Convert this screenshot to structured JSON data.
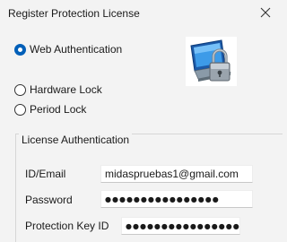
{
  "window": {
    "title": "Register Protection License",
    "close_icon": "close-icon"
  },
  "license_type": {
    "options": [
      {
        "label": "Web Authentication",
        "checked": true
      },
      {
        "label": "Hardware Lock",
        "checked": false
      },
      {
        "label": "Period Lock",
        "checked": false
      }
    ]
  },
  "logo": {
    "icon": "computer-padlock-icon"
  },
  "auth_group": {
    "legend": "License Authentication",
    "fields": {
      "email": {
        "label": "ID/Email",
        "value": "midaspruebas1@gmail.com"
      },
      "password": {
        "label": "Password",
        "value": "●●●●●●●●●●●●●●●●"
      },
      "protection_key": {
        "label": "Protection Key ID",
        "value": "●●●●●●●●●●●●●●●●"
      }
    }
  },
  "colors": {
    "accent": "#005fb8",
    "window_bg": "#f3f3f3"
  }
}
